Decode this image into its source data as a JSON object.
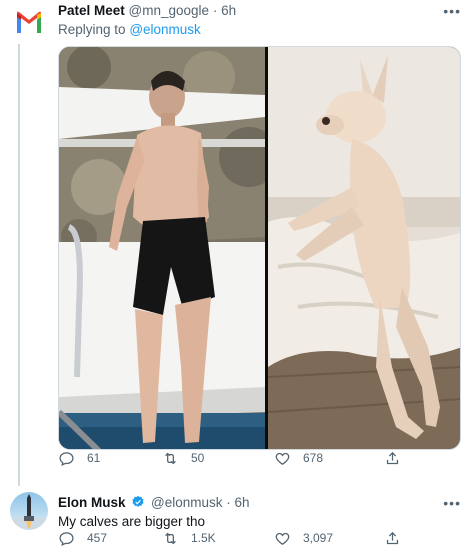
{
  "tweets": [
    {
      "author": {
        "name": "Patel Meet",
        "handle": "@mn_google",
        "time": "6h",
        "avatar_icon": "gmail-logo-icon"
      },
      "replying_to_prefix": "Replying to",
      "replying_to_handle": "@elonmusk",
      "media": {
        "left_image": "shirtless-man-on-boat",
        "right_image": "standing-french-bulldog"
      },
      "actions": {
        "replies": "61",
        "retweets": "50",
        "likes": "678"
      }
    },
    {
      "author": {
        "name": "Elon Musk",
        "handle": "@elonmusk",
        "time": "6h",
        "verified": true,
        "avatar_icon": "rocket-launch-avatar"
      },
      "text": "My calves are bigger tho",
      "actions": {
        "replies": "457",
        "retweets": "1.5K",
        "likes": "3,097"
      }
    }
  ],
  "colors": {
    "text_primary": "#0f1419",
    "text_secondary": "#536471",
    "link_blue": "#1d9bf0",
    "divider": "#cfd9de"
  },
  "icons": [
    "more-icon",
    "reply-icon",
    "retweet-icon",
    "like-icon",
    "share-icon",
    "verified-icon"
  ]
}
